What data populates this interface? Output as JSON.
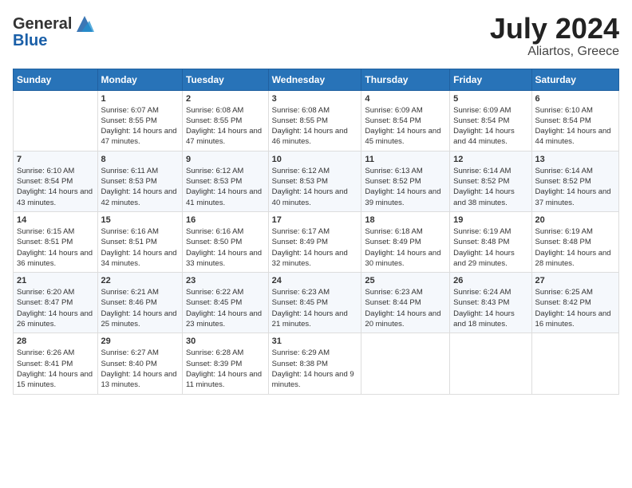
{
  "logo": {
    "line1": "General",
    "line2": "Blue"
  },
  "title": "July 2024",
  "subtitle": "Aliartos, Greece",
  "days": [
    "Sunday",
    "Monday",
    "Tuesday",
    "Wednesday",
    "Thursday",
    "Friday",
    "Saturday"
  ],
  "weeks": [
    [
      {
        "day": null,
        "content": null
      },
      {
        "day": "1",
        "sunrise": "6:07 AM",
        "sunset": "8:55 PM",
        "daylight": "14 hours and 47 minutes."
      },
      {
        "day": "2",
        "sunrise": "6:08 AM",
        "sunset": "8:55 PM",
        "daylight": "14 hours and 47 minutes."
      },
      {
        "day": "3",
        "sunrise": "6:08 AM",
        "sunset": "8:55 PM",
        "daylight": "14 hours and 46 minutes."
      },
      {
        "day": "4",
        "sunrise": "6:09 AM",
        "sunset": "8:54 PM",
        "daylight": "14 hours and 45 minutes."
      },
      {
        "day": "5",
        "sunrise": "6:09 AM",
        "sunset": "8:54 PM",
        "daylight": "14 hours and 44 minutes."
      },
      {
        "day": "6",
        "sunrise": "6:10 AM",
        "sunset": "8:54 PM",
        "daylight": "14 hours and 44 minutes."
      }
    ],
    [
      {
        "day": "7",
        "sunrise": "6:10 AM",
        "sunset": "8:54 PM",
        "daylight": "14 hours and 43 minutes."
      },
      {
        "day": "8",
        "sunrise": "6:11 AM",
        "sunset": "8:53 PM",
        "daylight": "14 hours and 42 minutes."
      },
      {
        "day": "9",
        "sunrise": "6:12 AM",
        "sunset": "8:53 PM",
        "daylight": "14 hours and 41 minutes."
      },
      {
        "day": "10",
        "sunrise": "6:12 AM",
        "sunset": "8:53 PM",
        "daylight": "14 hours and 40 minutes."
      },
      {
        "day": "11",
        "sunrise": "6:13 AM",
        "sunset": "8:52 PM",
        "daylight": "14 hours and 39 minutes."
      },
      {
        "day": "12",
        "sunrise": "6:14 AM",
        "sunset": "8:52 PM",
        "daylight": "14 hours and 38 minutes."
      },
      {
        "day": "13",
        "sunrise": "6:14 AM",
        "sunset": "8:52 PM",
        "daylight": "14 hours and 37 minutes."
      }
    ],
    [
      {
        "day": "14",
        "sunrise": "6:15 AM",
        "sunset": "8:51 PM",
        "daylight": "14 hours and 36 minutes."
      },
      {
        "day": "15",
        "sunrise": "6:16 AM",
        "sunset": "8:51 PM",
        "daylight": "14 hours and 34 minutes."
      },
      {
        "day": "16",
        "sunrise": "6:16 AM",
        "sunset": "8:50 PM",
        "daylight": "14 hours and 33 minutes."
      },
      {
        "day": "17",
        "sunrise": "6:17 AM",
        "sunset": "8:49 PM",
        "daylight": "14 hours and 32 minutes."
      },
      {
        "day": "18",
        "sunrise": "6:18 AM",
        "sunset": "8:49 PM",
        "daylight": "14 hours and 30 minutes."
      },
      {
        "day": "19",
        "sunrise": "6:19 AM",
        "sunset": "8:48 PM",
        "daylight": "14 hours and 29 minutes."
      },
      {
        "day": "20",
        "sunrise": "6:19 AM",
        "sunset": "8:48 PM",
        "daylight": "14 hours and 28 minutes."
      }
    ],
    [
      {
        "day": "21",
        "sunrise": "6:20 AM",
        "sunset": "8:47 PM",
        "daylight": "14 hours and 26 minutes."
      },
      {
        "day": "22",
        "sunrise": "6:21 AM",
        "sunset": "8:46 PM",
        "daylight": "14 hours and 25 minutes."
      },
      {
        "day": "23",
        "sunrise": "6:22 AM",
        "sunset": "8:45 PM",
        "daylight": "14 hours and 23 minutes."
      },
      {
        "day": "24",
        "sunrise": "6:23 AM",
        "sunset": "8:45 PM",
        "daylight": "14 hours and 21 minutes."
      },
      {
        "day": "25",
        "sunrise": "6:23 AM",
        "sunset": "8:44 PM",
        "daylight": "14 hours and 20 minutes."
      },
      {
        "day": "26",
        "sunrise": "6:24 AM",
        "sunset": "8:43 PM",
        "daylight": "14 hours and 18 minutes."
      },
      {
        "day": "27",
        "sunrise": "6:25 AM",
        "sunset": "8:42 PM",
        "daylight": "14 hours and 16 minutes."
      }
    ],
    [
      {
        "day": "28",
        "sunrise": "6:26 AM",
        "sunset": "8:41 PM",
        "daylight": "14 hours and 15 minutes."
      },
      {
        "day": "29",
        "sunrise": "6:27 AM",
        "sunset": "8:40 PM",
        "daylight": "14 hours and 13 minutes."
      },
      {
        "day": "30",
        "sunrise": "6:28 AM",
        "sunset": "8:39 PM",
        "daylight": "14 hours and 11 minutes."
      },
      {
        "day": "31",
        "sunrise": "6:29 AM",
        "sunset": "8:38 PM",
        "daylight": "14 hours and 9 minutes."
      },
      {
        "day": null,
        "content": null
      },
      {
        "day": null,
        "content": null
      },
      {
        "day": null,
        "content": null
      }
    ]
  ]
}
